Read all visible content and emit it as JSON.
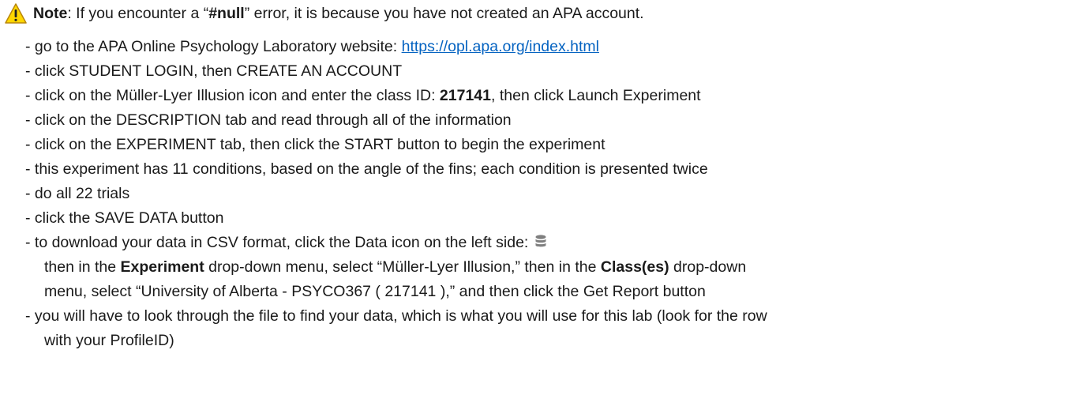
{
  "note": {
    "label": "Note",
    "text_before": ": If you encounter a “",
    "error_code": "#null",
    "text_after": "” error, it is because you have not created an APA account."
  },
  "steps": {
    "s1_text": "- go to the APA Online Psychology Laboratory website: ",
    "s1_link": "https://opl.apa.org/index.html",
    "s2": "- click STUDENT LOGIN, then CREATE AN ACCOUNT",
    "s3_before": "- click on the Müller-Lyer Illusion icon and enter the class ID: ",
    "s3_id": "217141",
    "s3_after": ", then click Launch Experiment",
    "s4": "- click on the DESCRIPTION tab and read through all of the information",
    "s5": "- click on the EXPERIMENT tab, then click the START button to begin the experiment",
    "s6": "- this experiment has 11 conditions, based on the angle of the fins; each condition is presented twice",
    "s7": "- do all 22 trials",
    "s8": "- click the SAVE DATA button",
    "s9": "- to download your data in CSV format, click the Data icon on the left side: ",
    "s9b_before": "then in the ",
    "s9b_bold1": "Experiment",
    "s9b_middle": " drop-down menu, select “Müller-Lyer Illusion,” then in the ",
    "s9b_bold2": "Class(es)",
    "s9b_after": " drop-down",
    "s9c": "menu, select “University of Alberta - PSYCO367 ( 217141 ),” and then click the Get Report button",
    "s10": "- you will have to look through the file to find your data, which is what you will use for this lab (look for the row",
    "s10b": "with your ProfileID)"
  },
  "colors": {
    "link": "#0563c1",
    "warning_fill": "#ffd700",
    "database_icon": "#7f7f7f"
  },
  "icons": {
    "warning": "warning-triangle-icon",
    "data": "database-icon"
  }
}
